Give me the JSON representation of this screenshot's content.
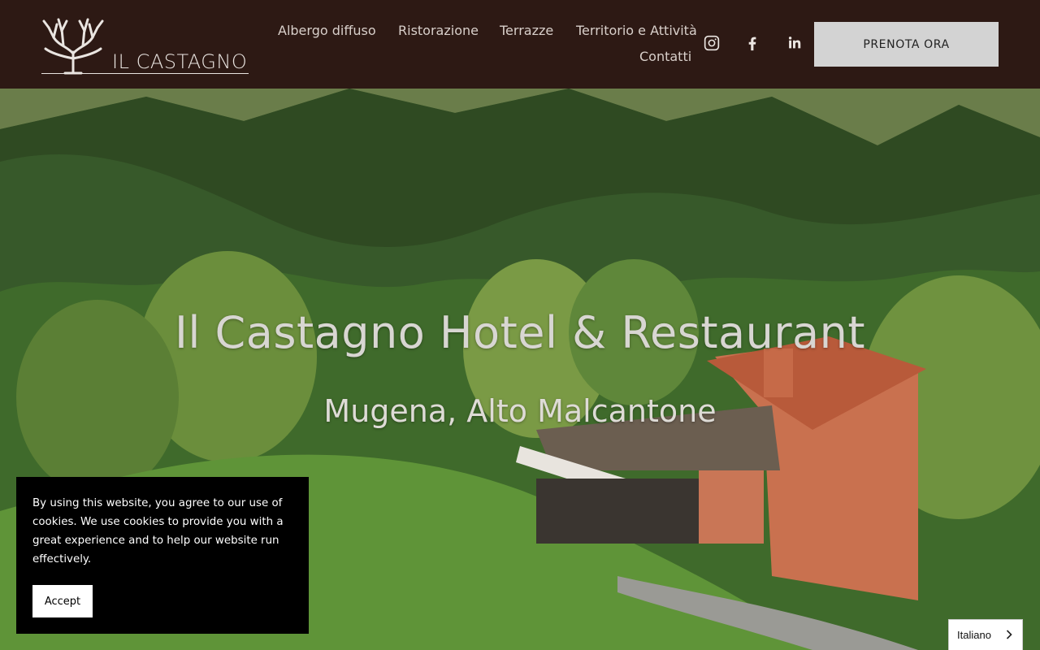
{
  "brand": {
    "name": "IL CASTAGNO"
  },
  "nav": {
    "items": [
      "Albergo diffuso",
      "Ristorazione",
      "Terrazze",
      "Territorio e Attività",
      "Contatti"
    ]
  },
  "social": [
    "instagram-icon",
    "facebook-icon",
    "linkedin-icon"
  ],
  "cta": {
    "label": "PRENOTA ORA"
  },
  "hero": {
    "title": "Il Castagno Hotel & Restaurant",
    "subtitle": "Mugena, Alto Malcantone"
  },
  "cookie": {
    "text": "By using this website, you agree to our use of cookies. We use cookies to provide you with a great experience and to help our website run effectively.",
    "accept": "Accept"
  },
  "language": {
    "selected": "Italiano"
  },
  "colors": {
    "header_bg": "#2d1914",
    "cta_bg": "#d3d3d3",
    "cookie_bg": "#000000"
  }
}
